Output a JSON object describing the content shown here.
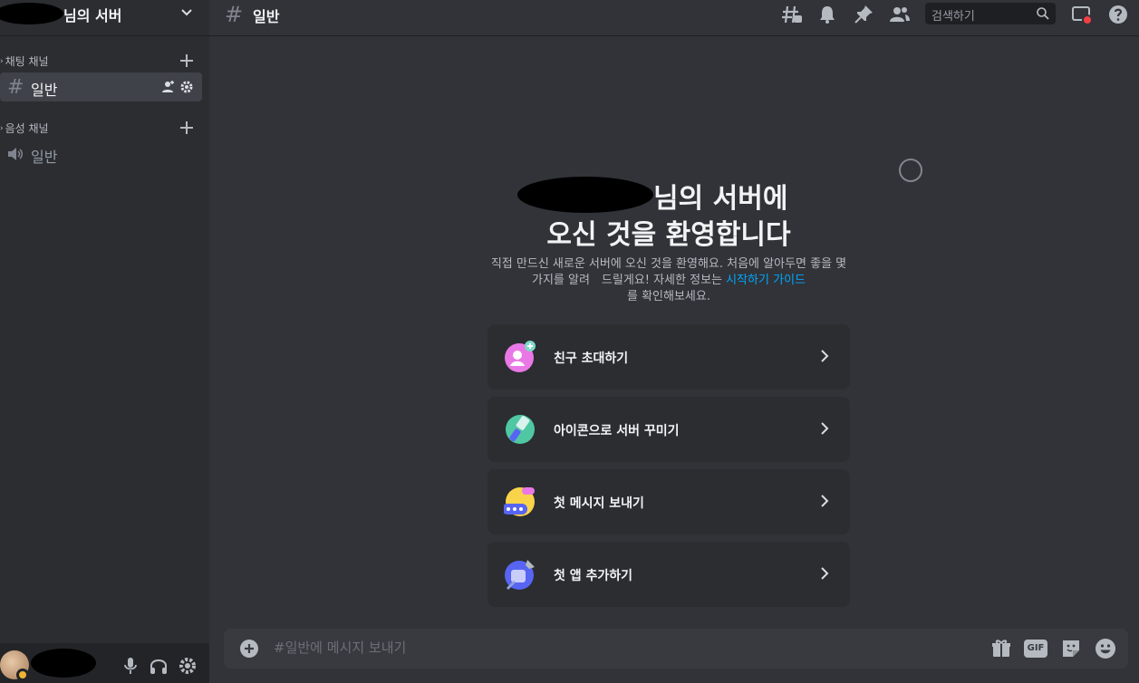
{
  "server": {
    "name_suffix": "님의 서버"
  },
  "sidebar": {
    "categories": [
      {
        "label": "채팅 채널"
      },
      {
        "label": "음성 채널"
      }
    ],
    "text_channel": {
      "label": "일반"
    },
    "voice_channel": {
      "label": "일반"
    }
  },
  "header": {
    "channel_name": "일반",
    "search_placeholder": "검색하기"
  },
  "welcome": {
    "title_line1_suffix": "님의 서버에",
    "title_line2": "오신 것을 환영합니다",
    "desc_part1": "직접 만드신 새로운 서버에 오신 것을 환영해요. 처음에 알아두면 좋을 몇 가지를 알려　드릴게요! 자세한 정보는 ",
    "desc_link": "시작하기 가이드",
    "desc_part2": "를 확인해보세요.",
    "cards": [
      {
        "label": "친구 초대하기"
      },
      {
        "label": "아이콘으로 서버 꾸미기"
      },
      {
        "label": "첫 메시지 보내기"
      },
      {
        "label": "첫 앱 추가하기"
      }
    ]
  },
  "composer": {
    "placeholder": "#일반에 메시지 보내기",
    "gif_label": "GIF"
  },
  "colors": {
    "accent_link": "#00a8fc",
    "notification_red": "#f23f43"
  }
}
